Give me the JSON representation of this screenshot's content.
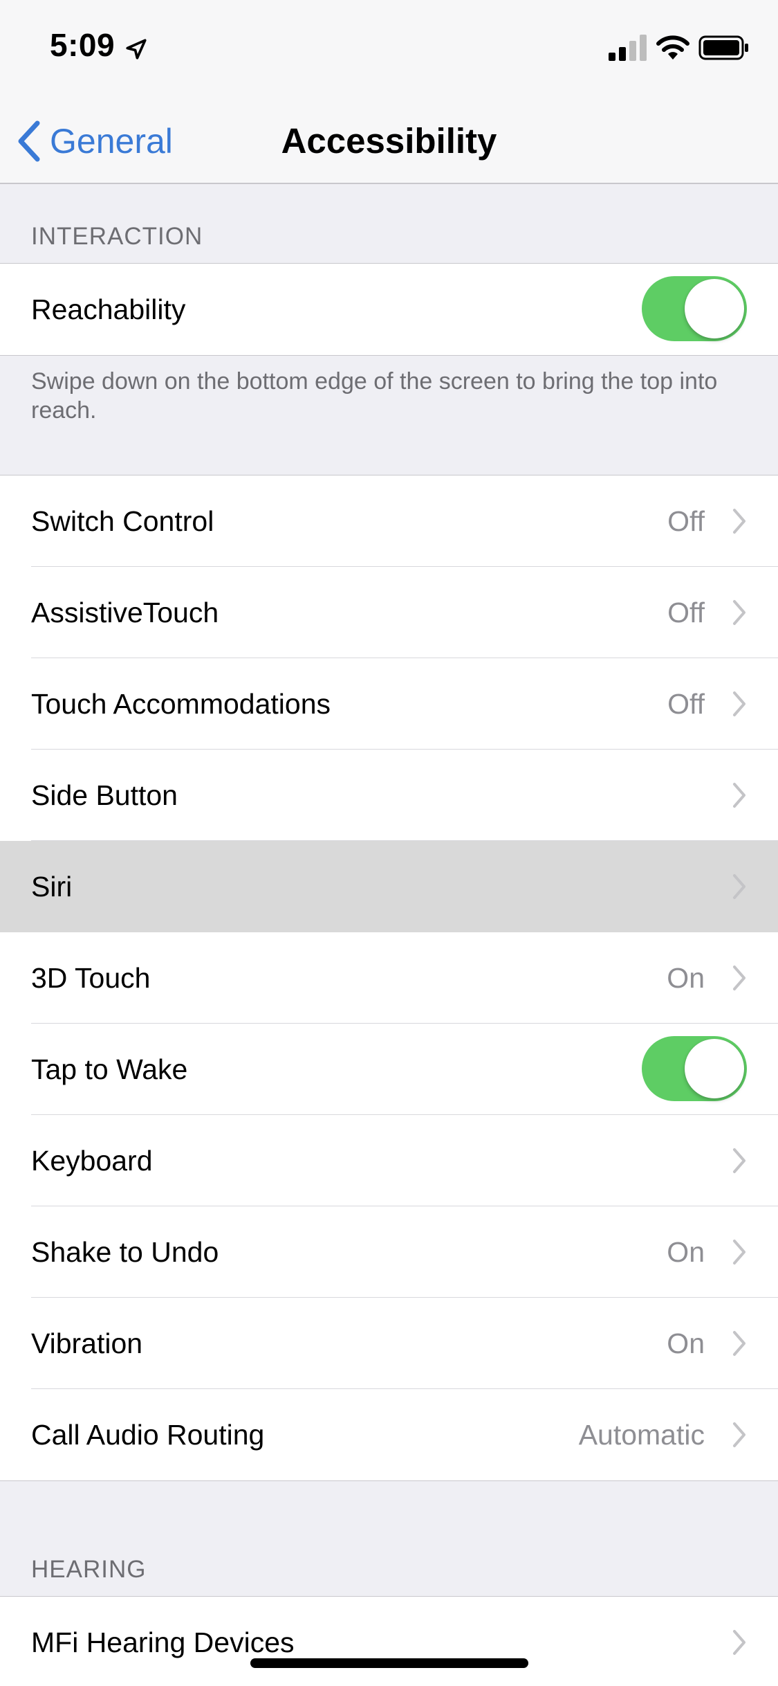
{
  "status_bar": {
    "time": "5:09"
  },
  "nav": {
    "back_label": "General",
    "title": "Accessibility"
  },
  "sections": {
    "interaction_header": "INTERACTION",
    "hearing_header": "HEARING"
  },
  "reachability": {
    "label": "Reachability",
    "toggle_on": true,
    "footer": "Swipe down on the bottom edge of the screen to bring the top into reach."
  },
  "interaction_rows": [
    {
      "label": "Switch Control",
      "value": "Off"
    },
    {
      "label": "AssistiveTouch",
      "value": "Off"
    },
    {
      "label": "Touch Accommodations",
      "value": "Off"
    },
    {
      "label": "Side Button",
      "value": ""
    },
    {
      "label": "Siri",
      "value": ""
    },
    {
      "label": "3D Touch",
      "value": "On"
    },
    {
      "label": "Tap to Wake",
      "value": "",
      "toggle_on": true
    },
    {
      "label": "Keyboard",
      "value": ""
    },
    {
      "label": "Shake to Undo",
      "value": "On"
    },
    {
      "label": "Vibration",
      "value": "On"
    },
    {
      "label": "Call Audio Routing",
      "value": "Automatic"
    }
  ],
  "hearing_rows": [
    {
      "label": "MFi Hearing Devices",
      "value": ""
    }
  ],
  "colors": {
    "accent": "#3a7ad6",
    "toggle_on": "#5ecd64",
    "highlight": "#d9d9d9",
    "background": "#efeff4"
  }
}
